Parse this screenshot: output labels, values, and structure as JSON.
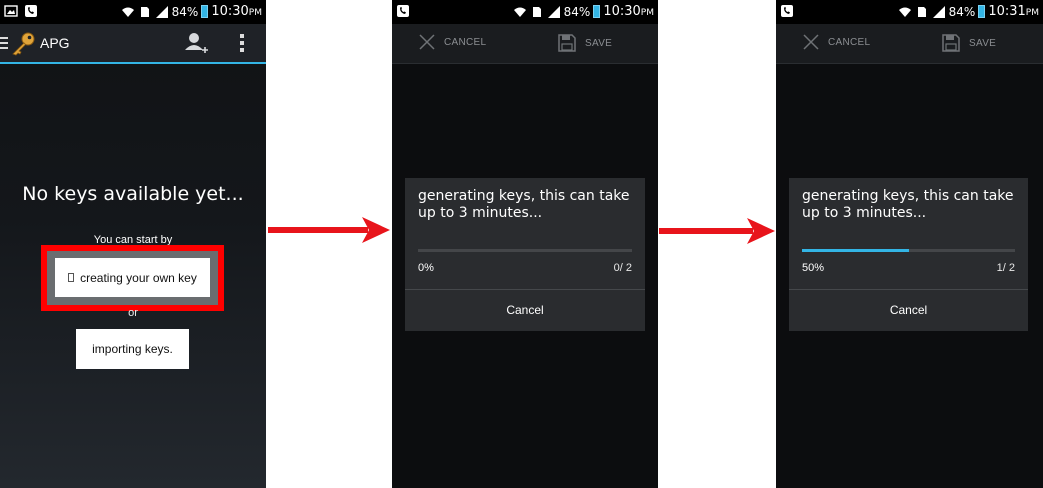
{
  "screens": [
    {
      "status": {
        "battery_pct": "84%",
        "time": "10:30",
        "ampm": "PM"
      },
      "app_title": "APG",
      "empty_title": "No keys available yet...",
      "start_by": "You can start by",
      "create_button_label": "creating your own key",
      "or_text": "or",
      "import_button_label": "importing keys."
    },
    {
      "status": {
        "battery_pct": "84%",
        "time": "10:30",
        "ampm": "PM"
      },
      "cancel_label": "CANCEL",
      "save_label": "SAVE",
      "dialog": {
        "message": "generating keys, this can take up to 3 minutes...",
        "progress": 0.0,
        "percent_text": "0%",
        "count_text": "0/ 2",
        "cancel_label": "Cancel"
      }
    },
    {
      "status": {
        "battery_pct": "84%",
        "time": "10:31",
        "ampm": "PM"
      },
      "cancel_label": "CANCEL",
      "save_label": "SAVE",
      "dialog": {
        "message": "generating keys, this can take up to 3 minutes...",
        "progress": 0.5,
        "percent_text": "50%",
        "count_text": "1/ 2",
        "cancel_label": "Cancel"
      }
    }
  ],
  "colors": {
    "accent": "#33b5e5",
    "highlight": "#ff0000",
    "arrow": "#e8141b"
  }
}
